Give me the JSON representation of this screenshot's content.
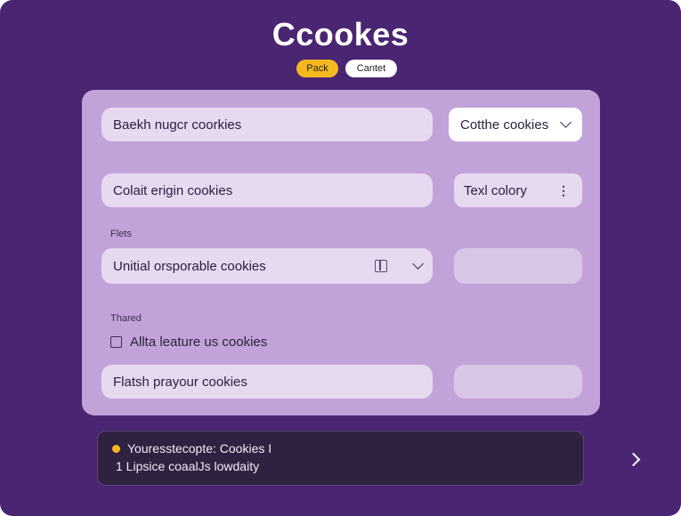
{
  "header": {
    "title": "Ccookes",
    "pill_primary": "Pack",
    "pill_secondary": "Cantet"
  },
  "form": {
    "field1": "Baekh nugcr coorkies",
    "dropdown1": "Cotthe cookies",
    "field2": "Colait erigin cookies",
    "dropdown2": "Texl colory",
    "section1_label": "Flets",
    "field3": "Unitial orsporable cookies",
    "section2_label": "Thared",
    "checkbox_label": "Allta leature us cookies",
    "checkbox_checked": false,
    "field4": "Flatsh prayour cookies"
  },
  "banner": {
    "line1": "Youresstecopte: Cookies I",
    "line2": "1  Lipsice coaalJs lowdaity"
  },
  "colors": {
    "background": "#4a2571",
    "panel": "#c2a3d9",
    "accent": "#f6b820",
    "banner": "#2f2240"
  },
  "icons": {
    "dropdown1": "chevron-down-icon",
    "dropdown2": "vertical-dots-icon",
    "field3_icon": "calendar-icon",
    "field3_chevron": "chevron-down-icon",
    "banner_dot": "status-dot-icon",
    "banner_arrow": "chevron-right-icon"
  }
}
